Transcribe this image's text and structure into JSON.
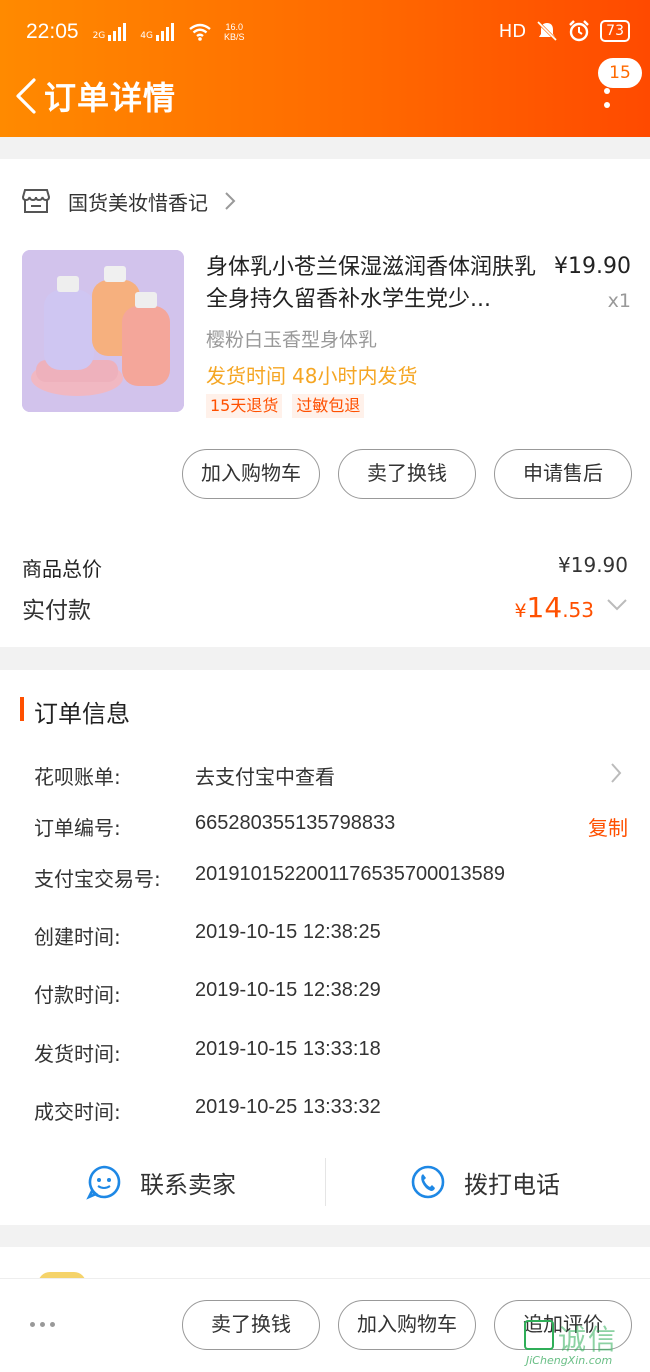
{
  "status_bar": {
    "time": "22:05",
    "net1": "2G",
    "net2": "4G",
    "speed_value": "16.0",
    "speed_unit": "KB/S",
    "hd": "HD",
    "battery": "73"
  },
  "header": {
    "title": "订单详情",
    "badge": "15"
  },
  "shop": {
    "name": "国货美妆惜香记"
  },
  "product": {
    "title": "身体乳小苍兰保湿滋润香体润肤乳全身持久留香补水学生党少...",
    "price": "¥19.90",
    "quantity": "x1",
    "sku": "樱粉白玉香型身体乳",
    "ship_label": "发货时间",
    "ship_value": "48小时内发货",
    "tags": [
      "15天退货",
      "过敏包退"
    ]
  },
  "item_actions": [
    "加入购物车",
    "卖了换钱",
    "申请售后"
  ],
  "summary": {
    "total_label": "商品总价",
    "total_value": "¥19.90",
    "paid_label": "实付款",
    "paid_currency": "¥",
    "paid_int": "14",
    "paid_dec": ".53"
  },
  "order_info": {
    "title": "订单信息",
    "rows": [
      {
        "label": "花呗账单:",
        "value": "去支付宝中查看"
      },
      {
        "label": "订单编号:",
        "value": "665280355135798833"
      },
      {
        "label": "支付宝交易号:",
        "value": "2019101522001176535700013589"
      },
      {
        "label": "创建时间:",
        "value": "2019-10-15 12:38:25"
      },
      {
        "label": "付款时间:",
        "value": "2019-10-15 12:38:29"
      },
      {
        "label": "发货时间:",
        "value": "2019-10-15 13:33:18"
      },
      {
        "label": "成交时间:",
        "value": "2019-10-25 13:33:32"
      }
    ],
    "copy_label": "复制"
  },
  "contact": {
    "seller": "联系卖家",
    "phone": "拨打电话"
  },
  "bottom_actions": [
    "卖了换钱",
    "加入购物车",
    "追加评价"
  ],
  "watermark": {
    "text": "诚信",
    "url": "JiChengXin.com"
  },
  "colors": {
    "accent": "#ff5000",
    "header_start": "#ff8a00",
    "header_end": "#ff4a00",
    "ship": "#f5a623"
  }
}
